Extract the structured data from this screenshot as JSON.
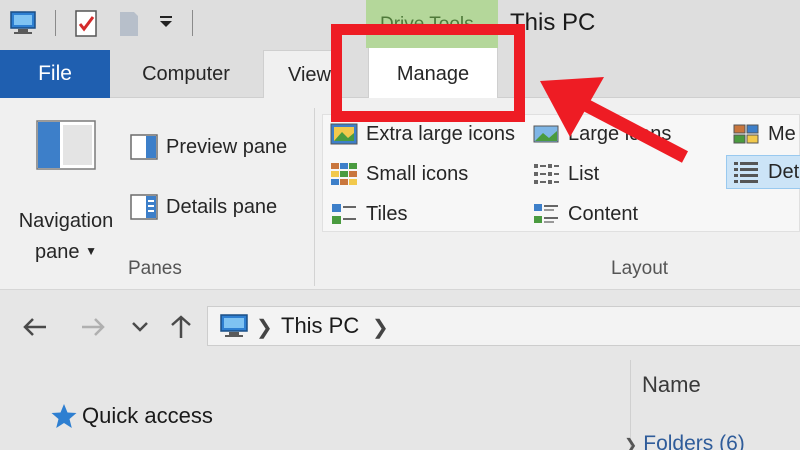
{
  "window": {
    "title": "This PC",
    "context_tab_group": "Drive Tools"
  },
  "quick_access_toolbar": {
    "icons": [
      "computer-icon",
      "properties-checkmark-icon",
      "new-folder-icon",
      "customize-dropdown-icon"
    ]
  },
  "ribbon_tabs": {
    "file": "File",
    "computer": "Computer",
    "view": "View",
    "manage": "Manage",
    "selected": "Manage"
  },
  "ribbon": {
    "panes_group": {
      "label": "Panes",
      "navigation_pane_line1": "Navigation",
      "navigation_pane_line2": "pane",
      "preview_pane": "Preview pane",
      "details_pane": "Details pane"
    },
    "layout_group": {
      "label": "Layout",
      "items": {
        "extra_large_icons": "Extra large icons",
        "large_icons": "Large icons",
        "medium_icons": "Me",
        "small_icons": "Small icons",
        "list": "List",
        "details": "Det",
        "tiles": "Tiles",
        "content": "Content"
      },
      "selected": "Details"
    }
  },
  "address_bar": {
    "location": "This PC"
  },
  "navigation_pane": {
    "quick_access": "Quick access"
  },
  "file_list": {
    "column_name": "Name",
    "group_folders": "Folders (6)"
  },
  "annotation": {
    "color": "#ee1c24",
    "target": "Manage"
  },
  "colors": {
    "file_tab": "#1f5fb0",
    "context_tab": "#b4d79a",
    "selected_item": "#cce4f7"
  }
}
